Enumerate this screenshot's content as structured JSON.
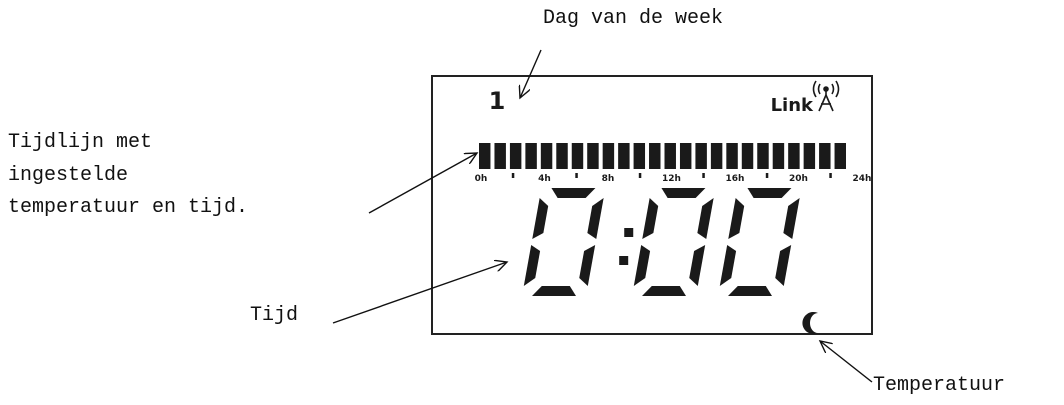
{
  "callouts": {
    "day_of_week": "Dag van de week",
    "timeline": [
      "Tijdlijn met",
      "ingestelde",
      "temperatuur en tijd."
    ],
    "time": "Tijd",
    "temperature": "Temperatuur"
  },
  "display": {
    "day_number": "1",
    "link_label": "Link",
    "time": "0:00",
    "timeline_ticks": [
      "0h",
      "4h",
      "8h",
      "12h",
      "16h",
      "20h",
      "24h"
    ],
    "timeline_segments": 24,
    "temperature_mode_icon": "moon-icon",
    "link_icon": "antenna-icon"
  }
}
